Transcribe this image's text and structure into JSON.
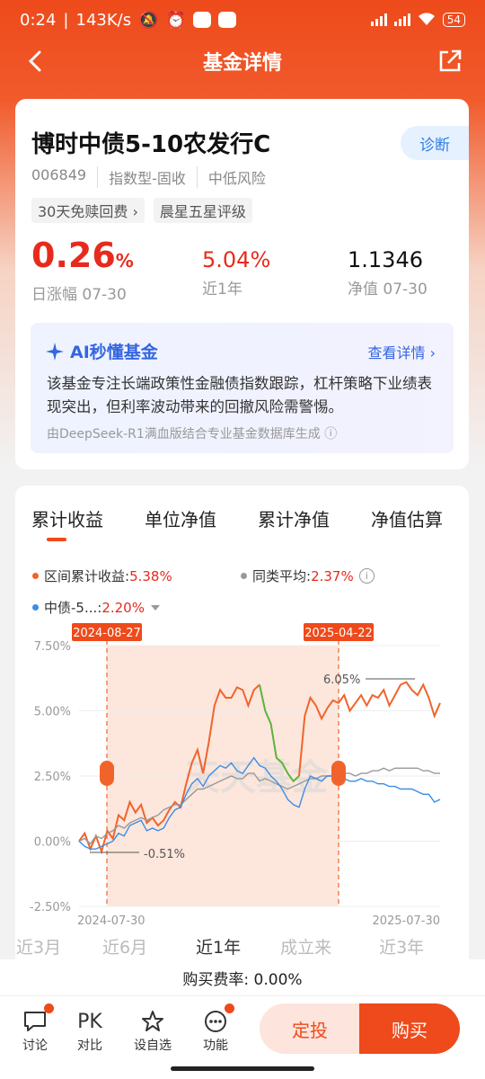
{
  "status": {
    "time": "0:24",
    "speed": "143K/s",
    "battery": "54"
  },
  "nav": {
    "title": "基金详情"
  },
  "fund": {
    "name": "博时中债5-10农发行C",
    "code": "006849",
    "type": "指数型-固收",
    "risk": "中低风险",
    "tags": [
      "30天免赎回费 ›",
      "晨星五星评级"
    ],
    "diagnose_label": "诊断",
    "daily_change": "0.26",
    "daily_change_unit": "%",
    "daily_change_label": "日涨幅 07-30",
    "year_return": "5.04%",
    "year_return_label": "近1年",
    "nav_value": "1.1346",
    "nav_label": "净值 07-30"
  },
  "ai": {
    "title": "AI秒懂基金",
    "link": "查看详情 ›",
    "text": "该基金专注长端政策性金融债指数跟踪，杠杆策略下业绩表现突出，但利率波动带来的回撤风险需警惕。",
    "source": "由DeepSeek-R1满血版结合专业基金数据库生成 ⓘ"
  },
  "tabs": [
    "累计收益",
    "单位净值",
    "累计净值",
    "净值估算"
  ],
  "legend": {
    "fund_label": "区间累计收益:",
    "fund_value": "5.38%",
    "peer_label": "同类平均:",
    "peer_value": "2.37%",
    "index_label": "中债-5...:",
    "index_value": "2.20%"
  },
  "colors": {
    "brand": "#ee4a1b",
    "fund_line": "#f0642c",
    "peer_line": "#999999",
    "index_line": "#3a8ee6",
    "drawdown_line": "#5ab43c"
  },
  "chart_data": {
    "type": "line",
    "x_start": "2024-07-30",
    "x_end": "2025-07-30",
    "yticks": [
      "7.50%",
      "5.00%",
      "2.50%",
      "0.00%",
      "-2.50%"
    ],
    "ylim": [
      -2.5,
      7.5
    ],
    "range_start_label": "2024-08-27",
    "range_end_label": "2025-04-22",
    "max_label": "6.05%",
    "min_label": "-0.51%",
    "watermark": "天天基金",
    "series": [
      {
        "name": "区间累计收益",
        "values": [
          0.0,
          0.3,
          -0.3,
          0.2,
          -0.4,
          0.4,
          0.1,
          1.0,
          0.8,
          1.5,
          1.1,
          1.4,
          0.7,
          0.9,
          0.6,
          0.8,
          1.2,
          1.5,
          1.3,
          2.2,
          3.0,
          3.5,
          2.6,
          3.8,
          5.2,
          5.8,
          5.5,
          5.5,
          5.9,
          5.8,
          5.2,
          5.8,
          6.0,
          5.0,
          4.5,
          3.2,
          3.0,
          2.6,
          2.3,
          2.5,
          4.8,
          5.5,
          5.2,
          4.7,
          5.1,
          5.4,
          5.3,
          5.6,
          5.0,
          5.3,
          5.6,
          5.2,
          5.6,
          5.5,
          5.8,
          5.2,
          5.6,
          6.0,
          6.1,
          5.8,
          5.6,
          6.0,
          5.5,
          4.8,
          5.3
        ]
      },
      {
        "name": "同类平均",
        "values": [
          0.0,
          0.1,
          -0.1,
          0.2,
          0.1,
          0.3,
          0.4,
          0.6,
          0.5,
          0.7,
          0.8,
          0.9,
          0.8,
          0.9,
          1.0,
          1.2,
          1.3,
          1.4,
          1.4,
          1.6,
          1.8,
          2.0,
          2.0,
          2.1,
          2.2,
          2.3,
          2.4,
          2.5,
          2.4,
          2.4,
          2.6,
          2.6,
          2.3,
          2.4,
          2.3,
          2.2,
          2.1,
          2.0,
          2.1,
          2.2,
          2.3,
          2.4,
          2.4,
          2.5,
          2.5,
          2.5,
          2.6,
          2.6,
          2.6,
          2.5,
          2.6,
          2.6,
          2.7,
          2.7,
          2.8,
          2.7,
          2.8,
          2.8,
          2.8,
          2.8,
          2.8,
          2.7,
          2.7,
          2.6,
          2.6
        ]
      },
      {
        "name": "中债-5...",
        "values": [
          0.0,
          -0.2,
          -0.3,
          -0.3,
          -0.2,
          -0.1,
          0.0,
          0.3,
          0.2,
          0.6,
          0.7,
          0.8,
          0.4,
          0.5,
          0.4,
          0.5,
          0.9,
          1.2,
          1.3,
          1.8,
          2.2,
          2.4,
          2.1,
          2.5,
          2.7,
          2.9,
          2.8,
          3.0,
          2.7,
          2.6,
          2.9,
          3.2,
          2.9,
          2.8,
          2.5,
          2.3,
          2.0,
          1.6,
          1.4,
          1.3,
          2.0,
          2.5,
          2.4,
          2.3,
          2.5,
          2.5,
          2.5,
          2.4,
          2.3,
          2.3,
          2.4,
          2.3,
          2.3,
          2.2,
          2.2,
          2.1,
          2.1,
          2.0,
          2.0,
          2.0,
          1.9,
          1.8,
          1.8,
          1.5,
          1.6
        ]
      }
    ]
  },
  "periods": [
    "近3月",
    "近6月",
    "近1年",
    "成立来",
    "近3年"
  ],
  "selected_period": "近1年",
  "fee": "购买费率: 0.00%",
  "bottom": {
    "discuss": "讨论",
    "compare_icon": "PK",
    "compare": "对比",
    "watch": "设自选",
    "function": "功能",
    "auto_invest": "定投",
    "buy": "购买"
  }
}
